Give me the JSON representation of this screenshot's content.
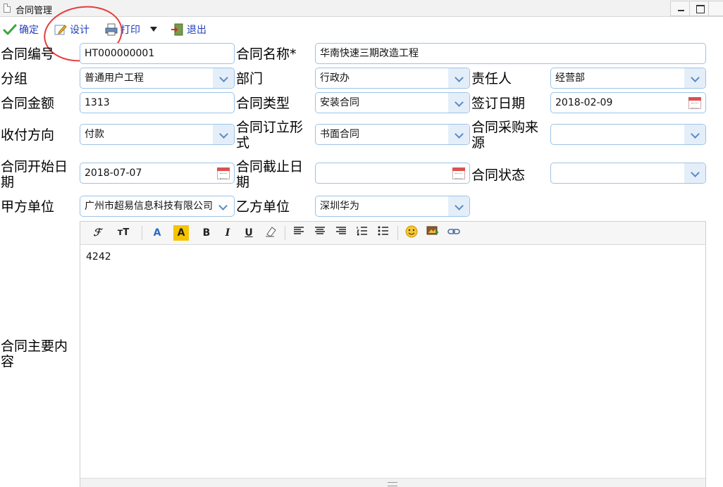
{
  "window": {
    "title": "合同管理"
  },
  "toolbar": {
    "confirm_label": "确定",
    "design_label": "设计",
    "print_label": "打印",
    "exit_label": "退出"
  },
  "form": {
    "contract_no_label": "合同编号",
    "contract_no_value": "HT000000001",
    "contract_name_label": "合同名称*",
    "contract_name_value": "华南快速三期改造工程",
    "group_label": "分组",
    "group_value": "普通用户工程",
    "dept_label": "部门",
    "dept_value": "行政办",
    "owner_label": "责任人",
    "owner_value": "经营部",
    "amount_label": "合同金额",
    "amount_value": "1313",
    "type_label": "合同类型",
    "type_value": "安装合同",
    "sign_date_label": "签订日期",
    "sign_date_value": "2018-02-09",
    "pay_direction_label": "收付方向",
    "pay_direction_value": "付款",
    "form_type_label": "合同订立形式",
    "form_type_value": "书面合同",
    "purchase_source_label": "合同采购来源",
    "purchase_source_value": "",
    "start_date_label": "合同开始日期",
    "start_date_value": "2018-07-07",
    "end_date_label": "合同截止日期",
    "end_date_value": "",
    "status_label": "合同状态",
    "status_value": "",
    "party_a_label": "甲方单位",
    "party_a_value": "广州市超易信息科技有限公司",
    "party_b_label": "乙方单位",
    "party_b_value": "深圳华为",
    "content_label": "合同主要内容",
    "content_value": "4242"
  },
  "editor_toolbar": {
    "font_family": "ℱ",
    "font_size": "ᴛT",
    "font_color": "A",
    "bg_color": "A",
    "bold": "B",
    "italic": "I",
    "underline": "U"
  },
  "colors": {
    "link_blue": "#1f3fbd",
    "field_border": "#9cc3e6",
    "annotation_red": "#e53b3b"
  }
}
